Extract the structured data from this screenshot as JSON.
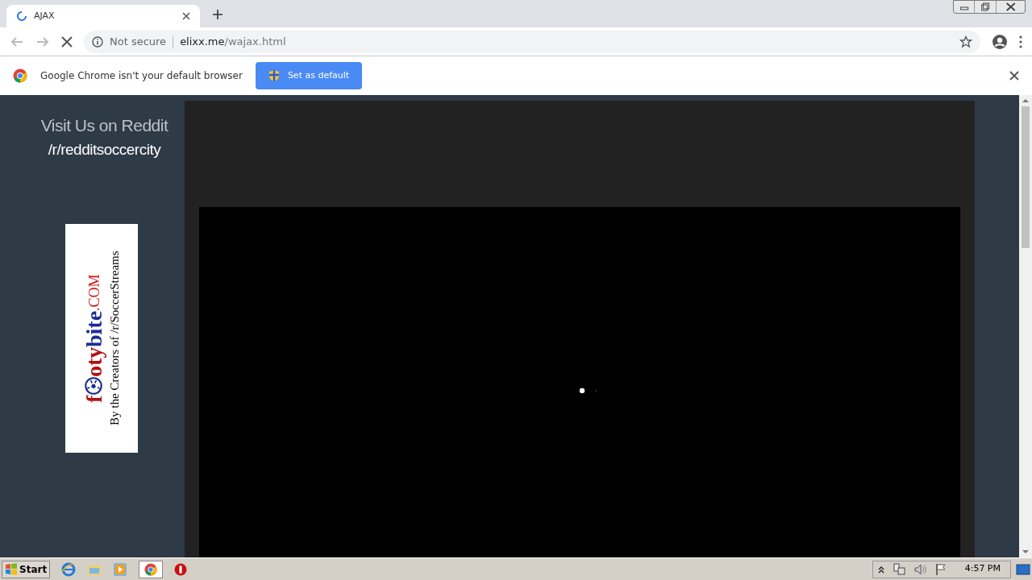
{
  "browser": {
    "tab": {
      "title": "AJAX",
      "loading": true
    },
    "address": {
      "security": "Not secure",
      "host": "elixx.me",
      "path": "/wajax.html"
    }
  },
  "infobar": {
    "message": "Google Chrome isn't your default browser",
    "button": "Set as default"
  },
  "sidebar": {
    "heading": "Visit Us on Reddit",
    "link": "/r/redditsoccercity",
    "banner": {
      "logo_parts": [
        {
          "text": "f",
          "color": "#b01212"
        },
        {
          "text": "oty",
          "color": "#b01212"
        },
        {
          "text": "bite",
          "color": "#1c2c94"
        },
        {
          "text": ".COM",
          "color": "#d01818"
        }
      ],
      "tagline": "By the Creators of /r/SoccerStreams"
    }
  },
  "taskbar": {
    "start": "Start",
    "clock": "4:57 PM"
  }
}
